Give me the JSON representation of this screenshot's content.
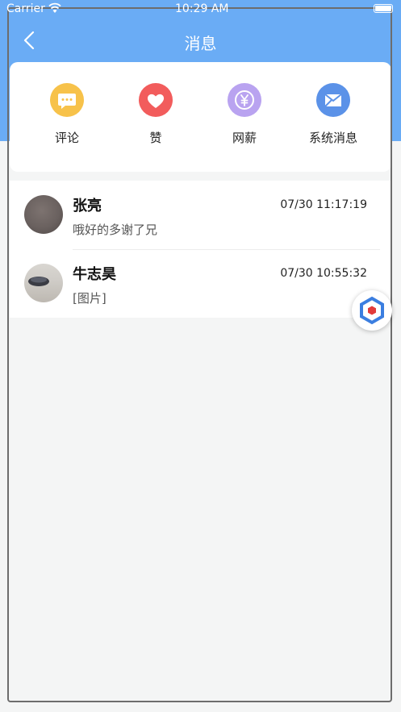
{
  "status_bar": {
    "carrier": "Carrier",
    "time": "10:29 AM"
  },
  "nav": {
    "title": "消息"
  },
  "categories": [
    {
      "label": "评论",
      "icon": "comment-icon",
      "color": "#f7c24a"
    },
    {
      "label": "赞",
      "icon": "heart-icon",
      "color": "#f25c5c"
    },
    {
      "label": "网薪",
      "icon": "yen-icon",
      "color": "#b9a3f0"
    },
    {
      "label": "系统消息",
      "icon": "envelope-icon",
      "color": "#5b92e8"
    }
  ],
  "messages": [
    {
      "name": "张亮",
      "time": "07/30 11:17:19",
      "preview": "哦好的多谢了兄"
    },
    {
      "name": "牛志昊",
      "time": "07/30 10:55:32",
      "preview": "[图片]"
    }
  ],
  "colors": {
    "header": "#6aacf5",
    "background": "#f4f5f5"
  }
}
